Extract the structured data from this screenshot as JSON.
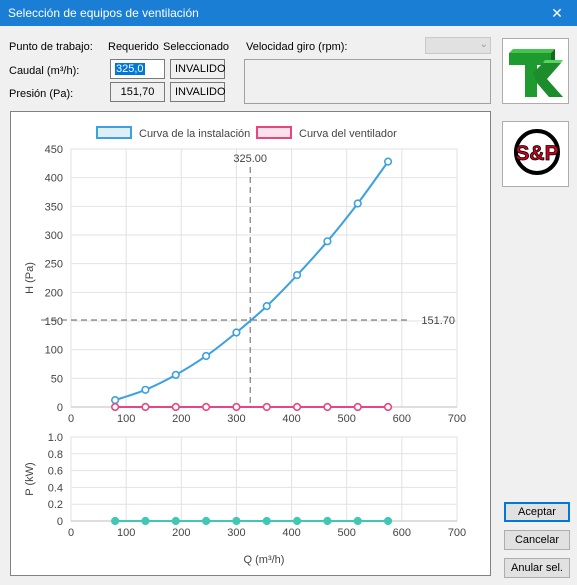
{
  "window": {
    "title": "Selección de equipos de ventilación",
    "close_glyph": "✕"
  },
  "form": {
    "punto_label": "Punto de trabajo:",
    "requerido_label": "Requerido",
    "seleccionado_label": "Seleccionado",
    "velocidad_label": "Velocidad giro (rpm):",
    "caudal_label": "Caudal (m³/h):",
    "presion_label": "Presión (Pa):",
    "caudal_requerido": "325,0",
    "caudal_seleccionado": "INVALIDO",
    "presion_requerido": "151,70",
    "presion_seleccionado": "INVALIDO",
    "velocidad_value": ""
  },
  "logos": {
    "tk": "TK",
    "sp": "S&P"
  },
  "buttons": {
    "accept": "Aceptar",
    "cancel": "Cancelar",
    "annul": "Anular sel."
  },
  "colors": {
    "titlebar": "#1a7fd4",
    "installation": "#3ba1e0",
    "fan": "#e8467c",
    "power": "#40c8b4",
    "accent": "#0078d7"
  },
  "chart_data": [
    {
      "type": "line",
      "legend_placement": "top-center",
      "series": [
        {
          "name": "Curva de la instalación",
          "x": [
            80,
            135,
            190,
            245,
            300,
            355,
            410,
            465,
            520,
            575
          ],
          "y": [
            12,
            30,
            56,
            89,
            130,
            176,
            230,
            289,
            355,
            428
          ]
        },
        {
          "name": "Curva del ventilador",
          "x": [
            80,
            135,
            190,
            245,
            300,
            355,
            410,
            465,
            520,
            575
          ],
          "y": [
            0,
            0,
            0,
            0,
            0,
            0,
            0,
            0,
            0,
            0
          ]
        }
      ],
      "xlim": [
        0,
        700
      ],
      "ylim": [
        0,
        450
      ],
      "ylabel": "H (Pa)",
      "xticks": [
        "0",
        "100",
        "200",
        "300",
        "400",
        "500",
        "600",
        "700"
      ],
      "yticks": [
        "0",
        "50",
        "100",
        "150",
        "200",
        "250",
        "300",
        "350",
        "400",
        "450"
      ],
      "reference_x": 325,
      "reference_x_label": "325.00",
      "reference_y": 151.7,
      "reference_y_label": "151.70",
      "grid": true
    },
    {
      "type": "line",
      "series": [
        {
          "x": [
            80,
            135,
            190,
            245,
            300,
            355,
            410,
            465,
            520,
            575
          ],
          "y": [
            0,
            0,
            0,
            0,
            0,
            0,
            0,
            0,
            0,
            0
          ]
        }
      ],
      "xlim": [
        0,
        700
      ],
      "ylim": [
        0,
        1
      ],
      "ylabel": "P (kW)",
      "xlabel": "Q (m³/h)",
      "xticks": [
        "0",
        "100",
        "200",
        "300",
        "400",
        "500",
        "600",
        "700"
      ],
      "yticks": [
        "0",
        "0.2",
        "0.4",
        "0.6",
        "0.8",
        "1.0"
      ],
      "grid": true
    }
  ]
}
